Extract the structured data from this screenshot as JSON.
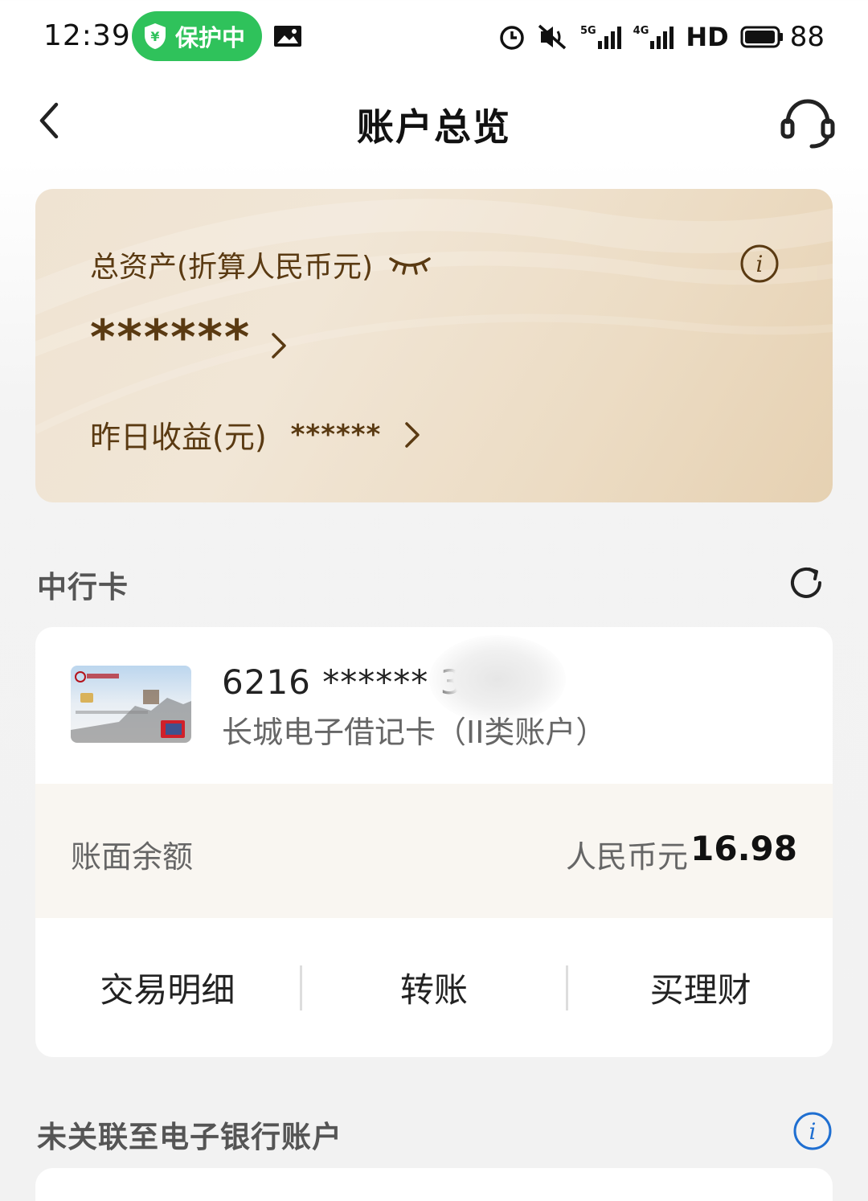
{
  "status_bar": {
    "time": "12:39",
    "protect_label": "保护中",
    "network_5g": "5G",
    "network_4g": "4G",
    "hd_label": "HD",
    "battery_level": "88",
    "accent_green": "#2fc25b"
  },
  "header": {
    "title": "账户总览",
    "back_icon": "chevron-left-icon",
    "service_icon": "headset-icon"
  },
  "assets": {
    "total_label": "总资产(折算人民币元)",
    "total_value": "******",
    "yesterday_label": "昨日收益(元)",
    "yesterday_value": "******"
  },
  "boc_section": {
    "title": "中行卡",
    "card_number": "6216 ****** 3",
    "card_type": "长城电子借记卡（II类账户）",
    "balance_label": "账面余额",
    "balance_currency": "人民币元",
    "balance_amount": "16.98",
    "actions": [
      "交易明细",
      "转账",
      "买理财"
    ]
  },
  "unlinked_section": {
    "title": "未关联至电子银行账户"
  },
  "colors": {
    "gold_text": "#5a3a12",
    "info_blue": "#1f6fd1"
  }
}
